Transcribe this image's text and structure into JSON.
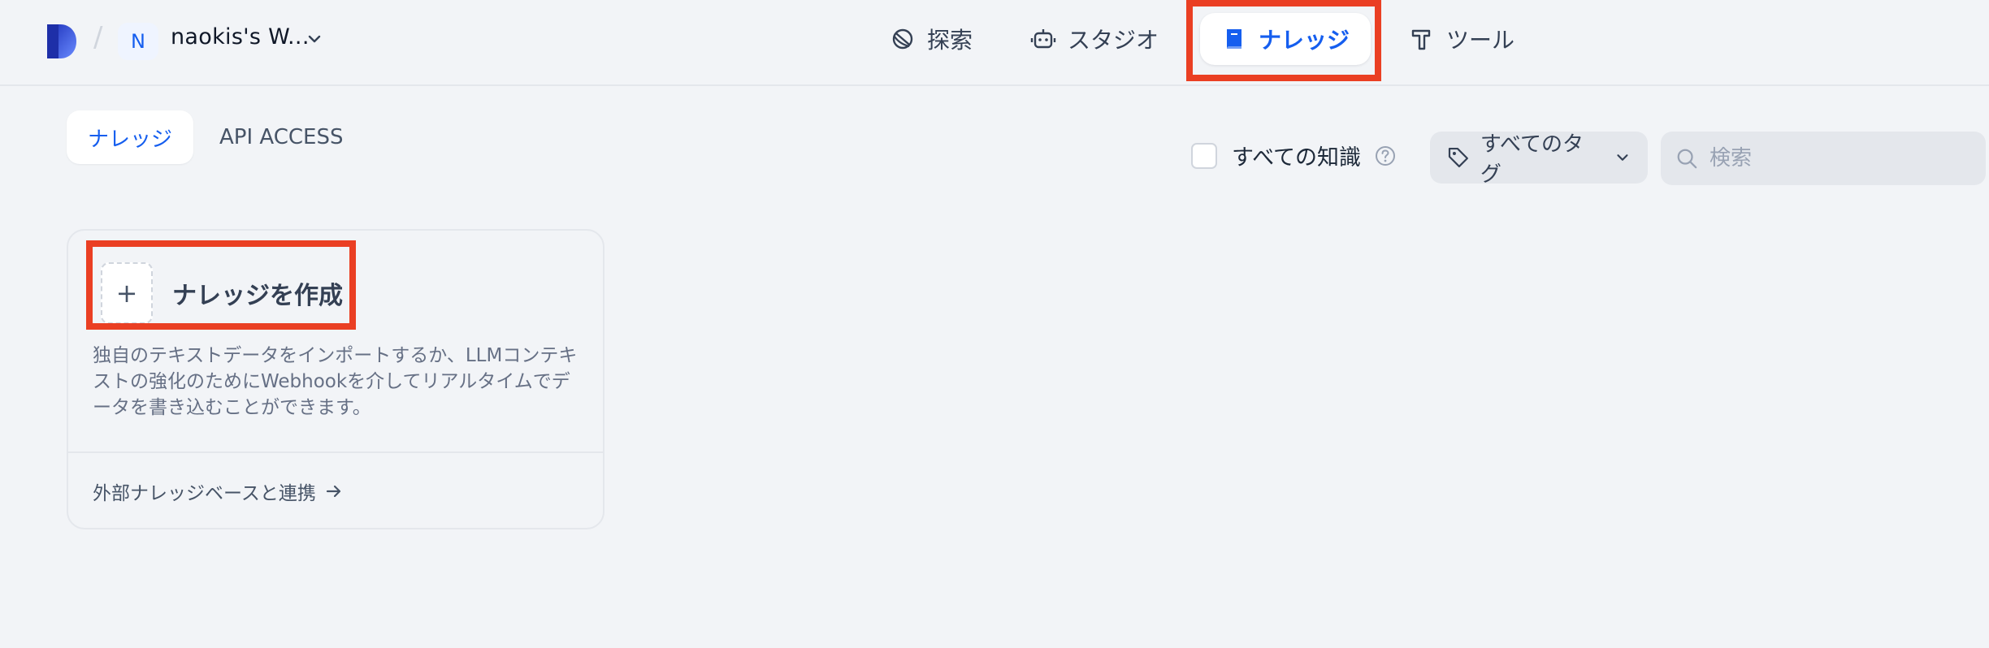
{
  "header": {
    "workspace_initial": "N",
    "workspace_name": "naokis's W...",
    "nav": [
      {
        "label": "探索",
        "icon": "compass-icon"
      },
      {
        "label": "スタジオ",
        "icon": "robot-icon"
      },
      {
        "label": "ナレッジ",
        "icon": "book-icon",
        "active": true
      },
      {
        "label": "ツール",
        "icon": "hammer-icon"
      }
    ]
  },
  "tabs": [
    {
      "label": "ナレッジ",
      "active": true
    },
    {
      "label": "API ACCESS",
      "active": false
    }
  ],
  "filters": {
    "all_knowledge_label": "すべての知識",
    "all_knowledge_checked": false,
    "tag_filter_label": "すべてのタグ",
    "search_placeholder": "検索"
  },
  "create_card": {
    "title": "ナレッジを作成",
    "plus": "+",
    "description": "独自のテキストデータをインポートするか、LLMコンテキストの強化のためにWebhookを介してリアルタイムでデータを書き込むことができます。",
    "external_link": "外部ナレッジベースと連携"
  },
  "colors": {
    "accent": "#155eef",
    "highlight": "#ea3f23",
    "background": "#f2f4f7"
  }
}
